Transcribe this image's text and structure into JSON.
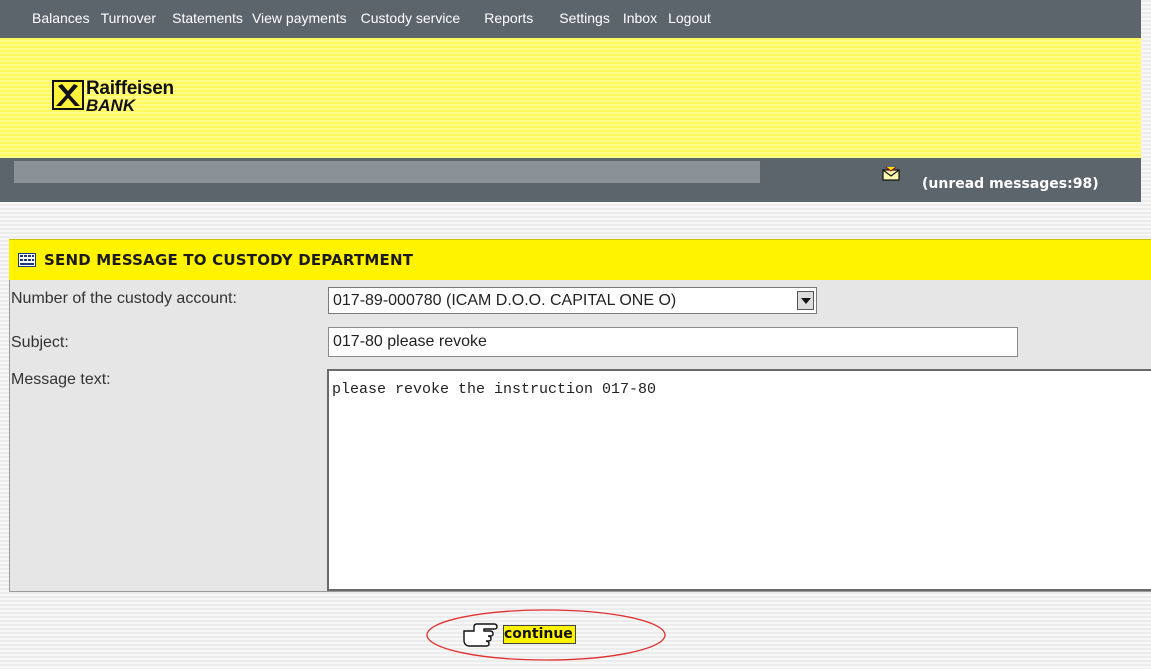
{
  "nav": {
    "items": [
      {
        "label": "Balances"
      },
      {
        "label": "Turnover"
      },
      {
        "label": "Statements"
      },
      {
        "label": "View payments"
      },
      {
        "label": "Custody service"
      },
      {
        "label": "Reports"
      },
      {
        "label": "Settings"
      },
      {
        "label": "Inbox"
      },
      {
        "label": "Logout"
      }
    ]
  },
  "brand": {
    "line1": "Raiffeisen",
    "line2": "BANK"
  },
  "status": {
    "unread_text": "(unread messages:98)",
    "icon": "envelope-icon"
  },
  "section": {
    "title": "SEND MESSAGE TO CUSTODY DEPARTMENT",
    "icon": "calculator-icon"
  },
  "form": {
    "account_label": "Number of the custody account:",
    "account_value": "017-89-000780 (ICAM D.O.O. CAPITAL ONE O)",
    "subject_label": "Subject:",
    "subject_value": "017-80 please revoke",
    "message_label": "Message text:",
    "message_value": "please revoke the instruction 017-80"
  },
  "actions": {
    "continue_label": "continue"
  },
  "colors": {
    "nav_bg": "#5d656c",
    "brand_yellow": "#fff300",
    "highlight_ellipse": "#e03030"
  }
}
